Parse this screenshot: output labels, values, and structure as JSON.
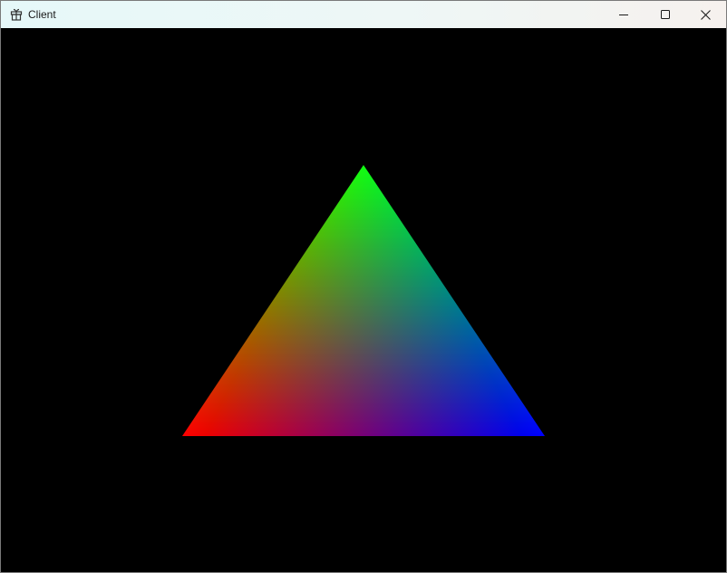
{
  "window": {
    "title": "Client",
    "app_icon": "gift-box-icon",
    "controls": {
      "minimize_icon": "minimize-icon",
      "maximize_icon": "maximize-icon",
      "close_icon": "close-icon"
    }
  },
  "scene": {
    "background_color": "#000000",
    "shape": "triangle",
    "vertex_colors": {
      "top": "#00ff00",
      "bottom_left": "#ff0000",
      "bottom_right": "#0000ff"
    }
  }
}
